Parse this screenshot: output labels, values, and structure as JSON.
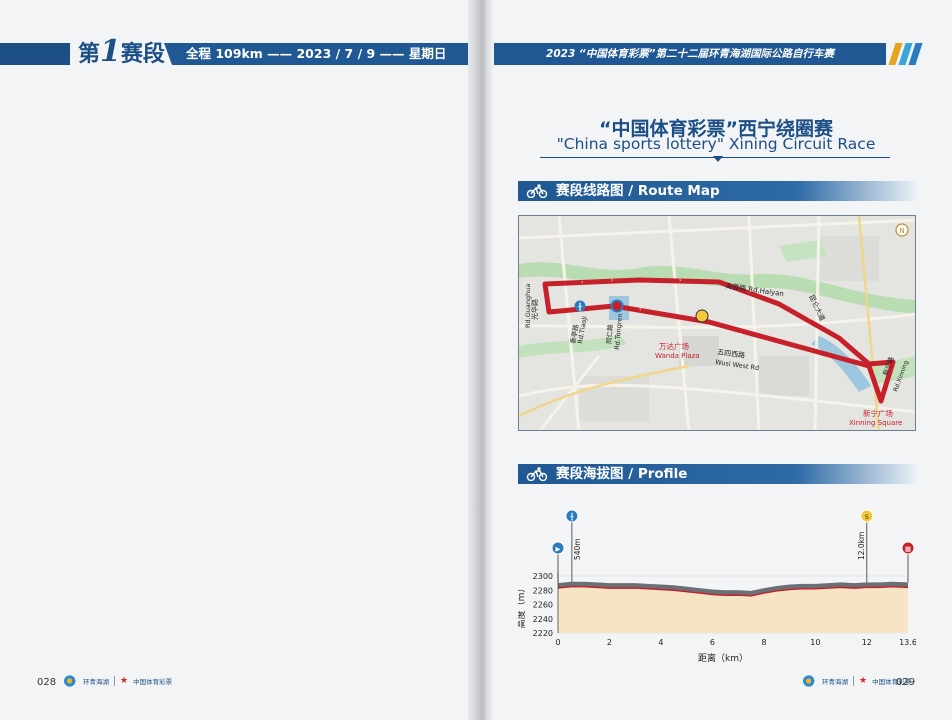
{
  "left_page": {
    "stage_prefix": "第",
    "stage_number": "1",
    "stage_suffix": "赛段",
    "info_bar": "全程 109km —— 2023 / 7 / 9 —— 星期日",
    "page_number": "028"
  },
  "right_page": {
    "header_bar": "2023 “中国体育彩票”第二十二届环青海湖国际公路自行车赛",
    "race_title_cn": "“中国体育彩票”西宁绕圈赛",
    "race_title_en": "\"China sports lottery\" Xining Circuit Race",
    "route_map_section": "赛段线路图 / Route Map",
    "profile_section": "赛段海拔图 / Profile",
    "page_number": "029"
  },
  "map": {
    "labels": {
      "guanghua": "光华路",
      "guanghua_en": "Rd.Guanghua",
      "haiyan": "海晏路 Rd.Haiyan",
      "tongren": "同仁路",
      "tongren_en": "Rd.Tongren",
      "tiaoji": "香亭路",
      "tiaoji_en": "Rd.TiaoJi",
      "wanda_cn": "万达广场",
      "wanda_en": "Wanda Plaza",
      "wusi_cn": "五四西路",
      "wusi_en": "Wusi West Rd",
      "kunlun": "昆仑大道",
      "xinning_rd": "新宁路",
      "xinning_rd_en": "Rd.Xinning",
      "xinning_cn": "新宁广场",
      "xinning_en": "Xinning Square",
      "north": "N"
    }
  },
  "profile": {
    "ylabel": "高度（m）",
    "xlabel": "距离（km）",
    "annotation_feed": "540m",
    "annotation_sprint": "12.0km"
  },
  "logos": {
    "event_logo": "环青海湖",
    "sponsor_logo": "中国体育彩票"
  },
  "colors": {
    "brand_blue": "#1f5892",
    "route_red": "#c6202b",
    "dots": [
      "#e5a51c",
      "#3aa5d8",
      "#2a7bbf"
    ]
  },
  "chart_data": {
    "type": "area",
    "title": "",
    "xlabel": "距离（km）",
    "ylabel": "高度（m）",
    "xlim": [
      0,
      13.6
    ],
    "ylim": [
      2220,
      2300
    ],
    "x_ticks": [
      0,
      2,
      4,
      6,
      8,
      10,
      12,
      13.6
    ],
    "y_ticks": [
      2220,
      2240,
      2260,
      2280,
      2300
    ],
    "series": [
      {
        "x": [
          0,
          0.5,
          1.0,
          1.5,
          2.0,
          2.5,
          3.0,
          3.5,
          4.0,
          4.5,
          5.0,
          5.5,
          6.0,
          6.5,
          7.0,
          7.5,
          8.0,
          8.5,
          9.0,
          9.5,
          10.0,
          10.5,
          11.0,
          11.5,
          12.0,
          12.5,
          13.0,
          13.6
        ],
        "y": [
          2283,
          2285,
          2285,
          2284,
          2283,
          2283,
          2283,
          2282,
          2281,
          2280,
          2278,
          2276,
          2274,
          2273,
          2273,
          2272,
          2276,
          2279,
          2281,
          2282,
          2282,
          2283,
          2284,
          2283,
          2284,
          2284,
          2285,
          2284
        ]
      }
    ],
    "markers": [
      {
        "type": "start",
        "km": 0
      },
      {
        "type": "feed",
        "km": 0.54
      },
      {
        "type": "sprint",
        "km": 12.0
      },
      {
        "type": "finish",
        "km": 13.6
      }
    ]
  }
}
